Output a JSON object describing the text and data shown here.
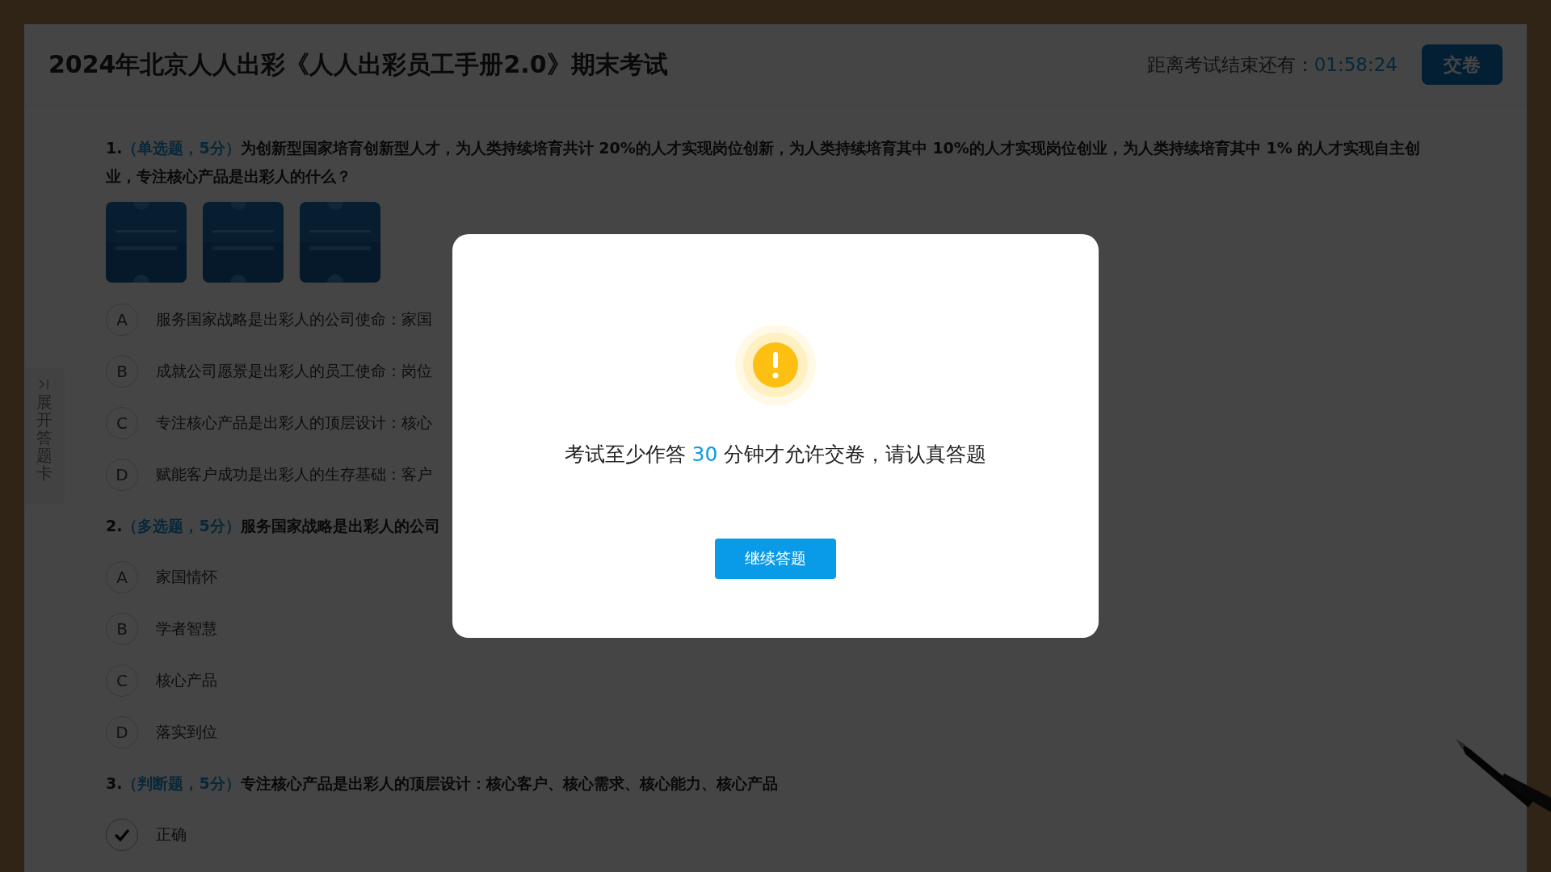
{
  "header": {
    "title": "2024年北京人人出彩《人人出彩员工手册2.0》期末考试",
    "timer_label": "距离考试结束还有：",
    "timer_value": "01:58:24",
    "submit_button": "交卷"
  },
  "side_tab": {
    "label": "展开答题卡"
  },
  "questions": [
    {
      "number": "1.",
      "type": "（单选题，5分）",
      "text": "为创新型国家培育创新型人才，为人类持续培育共计 20%的人才实现岗位创新，为人类持续培育其中 10%的人才实现岗位创业，为人类持续培育其中 1% 的人才实现自主创业，专注核心产品是出彩人的什么？",
      "options": [
        {
          "letter": "A",
          "label": "服务国家战略是出彩人的公司使命：家国",
          "selected": false
        },
        {
          "letter": "B",
          "label": "成就公司愿景是出彩人的员工使命：岗位",
          "selected": false
        },
        {
          "letter": "C",
          "label": "专注核心产品是出彩人的顶层设计：核心",
          "selected": false
        },
        {
          "letter": "D",
          "label": "赋能客户成功是出彩人的生存基础：客户",
          "selected": false
        }
      ]
    },
    {
      "number": "2.",
      "type": "（多选题，5分）",
      "text": "服务国家战略是出彩人的公司",
      "options": [
        {
          "letter": "A",
          "label": "家国情怀",
          "selected": false
        },
        {
          "letter": "B",
          "label": "学者智慧",
          "selected": false
        },
        {
          "letter": "C",
          "label": "核心产品",
          "selected": false
        },
        {
          "letter": "D",
          "label": "落实到位",
          "selected": false
        }
      ]
    },
    {
      "number": "3.",
      "type": "（判断题，5分）",
      "text": "专注核心产品是出彩人的顶层设计：核心客户、核心需求、核心能力、核心产品",
      "options": [
        {
          "label": "正确",
          "selected": true
        }
      ]
    }
  ],
  "dialog": {
    "message_before": "考试至少作答",
    "message_number": "30",
    "message_after": "分钟才允许交卷，请认真答题",
    "button": "继续答题"
  }
}
